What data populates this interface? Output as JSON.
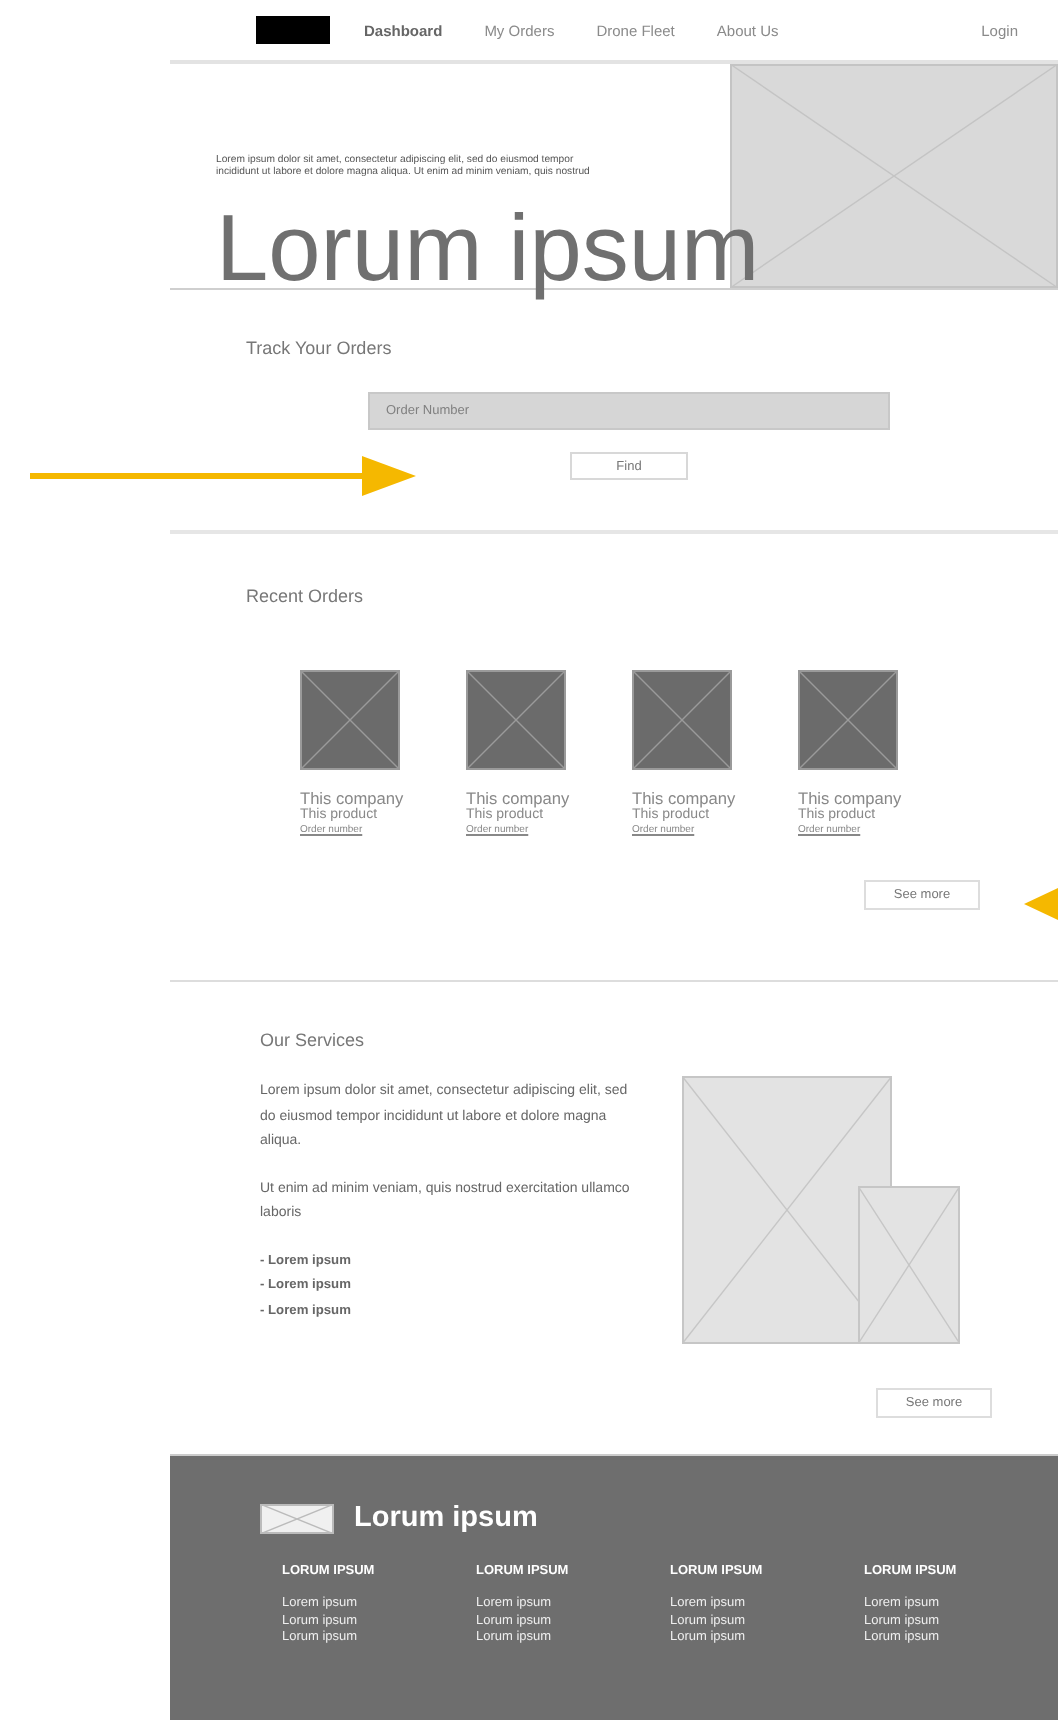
{
  "nav": {
    "items": [
      {
        "label": "Dashboard",
        "selected": true
      },
      {
        "label": "My Orders",
        "selected": false
      },
      {
        "label": "Drone Fleet",
        "selected": false
      },
      {
        "label": "About Us",
        "selected": false
      }
    ],
    "login": "Login"
  },
  "hero": {
    "text": "Lorem ipsum dolor sit amet, consectetur adipiscing elit, sed do eiusmod tempor incididunt ut labore et dolore magna aliqua. Ut enim ad minim veniam, quis nostrud",
    "title": "Lorum ipsum"
  },
  "track": {
    "title": "Track Your Orders",
    "placeholder": "Order Number",
    "button": "Find"
  },
  "recent": {
    "title": "Recent Orders",
    "orders": [
      {
        "company": "This company",
        "product": "This product",
        "order_number": "Order number"
      },
      {
        "company": "This company",
        "product": "This product",
        "order_number": "Order number"
      },
      {
        "company": "This company",
        "product": "This product",
        "order_number": "Order number"
      },
      {
        "company": "This company",
        "product": "This product",
        "order_number": "Order number"
      }
    ],
    "button": "See more"
  },
  "services": {
    "title": "Our Services",
    "paragraphs": [
      "Lorem ipsum dolor sit amet, consectetur adipiscing elit, sed do eiusmod tempor incididunt ut labore et dolore magna aliqua.",
      "Ut enim ad minim veniam, quis nostrud exercitation ullamco laboris"
    ],
    "bullets": [
      "- Lorem ipsum",
      "- Lorem ipsum",
      "- Lorem ipsum"
    ],
    "button": "See more"
  },
  "footer": {
    "brand": "Lorum ipsum",
    "columns": [
      {
        "heading": "LORUM IPSUM",
        "items": [
          "Lorem ipsum",
          "Lorum ipsum",
          "Lorum ipsum"
        ]
      },
      {
        "heading": "LORUM IPSUM",
        "items": [
          "Lorem ipsum",
          "Lorum ipsum",
          "Lorum ipsum"
        ]
      },
      {
        "heading": "LORUM IPSUM",
        "items": [
          "Lorem ipsum",
          "Lorum ipsum",
          "Lorum ipsum"
        ]
      },
      {
        "heading": "LORUM IPSUM",
        "items": [
          "Lorem ipsum",
          "Lorum ipsum",
          "Lorum ipsum"
        ]
      }
    ]
  }
}
